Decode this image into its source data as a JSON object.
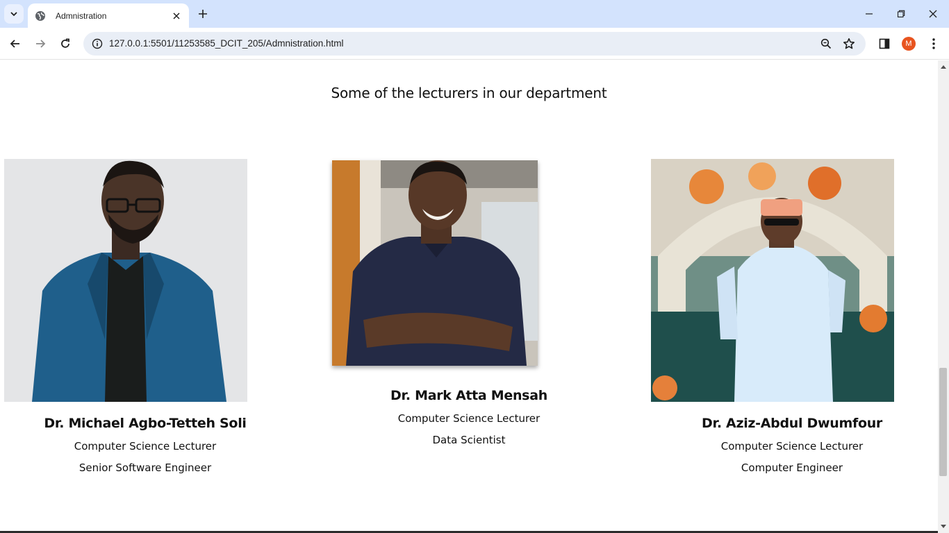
{
  "browser": {
    "tab_title": "Admnistration",
    "url": "127.0.0.1:5501/11253585_DCIT_205/Admnistration.html",
    "profile_initial": "M"
  },
  "page": {
    "heading": "Some of the lecturers in our department",
    "lecturers": [
      {
        "name": "Dr. Michael Agbo-Tetteh Soli",
        "role1": "Computer Science Lecturer",
        "role2": "Senior Software Engineer"
      },
      {
        "name": "Dr. Mark Atta Mensah",
        "role1": "Computer Science Lecturer",
        "role2": "Data Scientist"
      },
      {
        "name": "Dr. Aziz-Abdul Dwumfour",
        "role1": "Computer Science Lecturer",
        "role2": "Computer Engineer"
      }
    ]
  }
}
